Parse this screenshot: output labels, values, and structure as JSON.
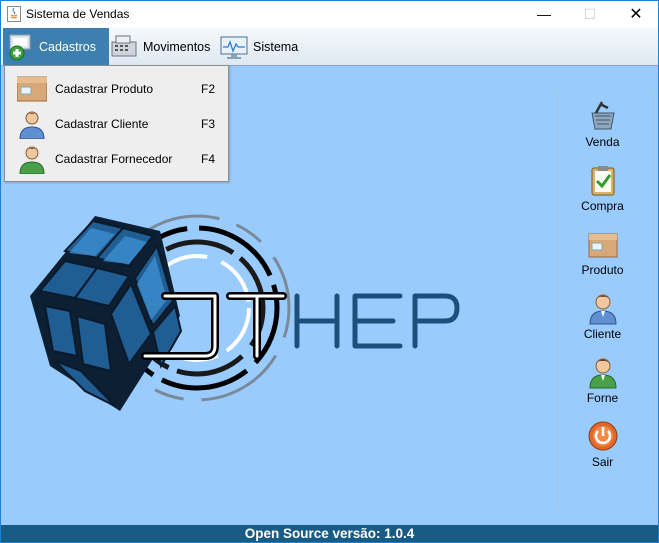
{
  "window": {
    "title": "Sistema de Vendas",
    "minimize_label": "—",
    "maximize_label": "☐",
    "close_label": "✕"
  },
  "menubar": {
    "items": [
      {
        "label": "Cadastros",
        "icon": "add-icon"
      },
      {
        "label": "Movimentos",
        "icon": "cash-register-icon"
      },
      {
        "label": "Sistema",
        "icon": "monitor-icon"
      }
    ]
  },
  "dropdown": {
    "items": [
      {
        "label": "Cadastrar Produto",
        "shortcut": "F2",
        "icon": "box-icon"
      },
      {
        "label": "Cadastrar Cliente",
        "shortcut": "F3",
        "icon": "user-icon"
      },
      {
        "label": "Cadastrar Fornecedor",
        "shortcut": "F4",
        "icon": "supplier-icon"
      }
    ]
  },
  "logo": {
    "text": "JTHEP"
  },
  "sidebar": {
    "buttons": [
      {
        "label": "Venda",
        "icon": "basket-icon"
      },
      {
        "label": "Compra",
        "icon": "clipboard-check-icon"
      },
      {
        "label": "Produto",
        "icon": "box-icon"
      },
      {
        "label": "Cliente",
        "icon": "user-icon"
      },
      {
        "label": "Forne",
        "icon": "supplier-icon"
      },
      {
        "label": "Sair",
        "icon": "power-icon"
      }
    ]
  },
  "status": {
    "text": "Open Source versão: 1.0.4"
  },
  "colors": {
    "background": "#9acbfd",
    "accent": "#3d7fae",
    "status": "#185b85"
  }
}
